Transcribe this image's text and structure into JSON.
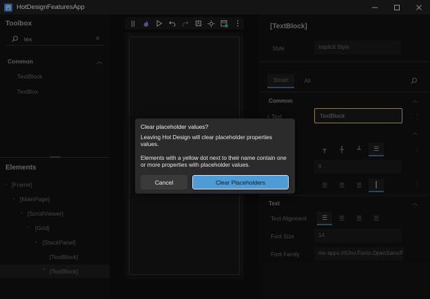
{
  "window": {
    "title": "HotDesignFeaturesApp",
    "controls": [
      "minimize-icon",
      "maximize-icon",
      "close-icon"
    ]
  },
  "toolbox": {
    "title": "Toolbox",
    "search_value": "tex",
    "group": "Common",
    "items": [
      "TextBlock",
      "TextBox"
    ]
  },
  "elements": {
    "title": "Elements",
    "tree": [
      {
        "label": "[Frame]",
        "dot": false
      },
      {
        "label": "[MainPage]",
        "dot": false
      },
      {
        "label": "[ScrollViewer]",
        "dot": false
      },
      {
        "label": "[Grid]",
        "dot": false
      },
      {
        "label": "[StackPanel]",
        "dot": false
      },
      {
        "label": "[TextBlock]",
        "dot": false
      },
      {
        "label": "[TextBlock]",
        "dot": true,
        "selected": true
      }
    ]
  },
  "canvas_toolbar": {
    "icons": [
      "drag-handle-icon",
      "hot-design-flame-icon",
      "play-icon",
      "undo-icon",
      "redo-icon",
      "screen-icon",
      "theme-icon",
      "save-icon",
      "more-icon"
    ]
  },
  "properties": {
    "title": "[TextBlock]",
    "style_label": "Style",
    "style_value": "Implicit Style",
    "tabs": [
      "Smart",
      "All"
    ],
    "common_section": "Common",
    "text_label": "Text",
    "text_value": "TextBlock",
    "margin_value": "0",
    "text_section": "Text",
    "text_alignment_label": "Text Alignment",
    "font_size_label": "Font Size",
    "font_size_value": "14",
    "font_family_label": "Font Family",
    "font_family_value": "ms-appx:///Uno.Fonts.OpenSans/Fo"
  },
  "dialog": {
    "title": "Clear placeholder values?",
    "message1": "Leaving Hot Design will clear placeholder properties values.",
    "message2": "Elements with a yellow dot next to their name contain one or more properties with placeholder values.",
    "cancel_label": "Cancel",
    "primary_label": "Clear Placeholders"
  },
  "colors": {
    "accent": "#4e9bd6",
    "placeholder_highlight": "#e3c44b"
  }
}
